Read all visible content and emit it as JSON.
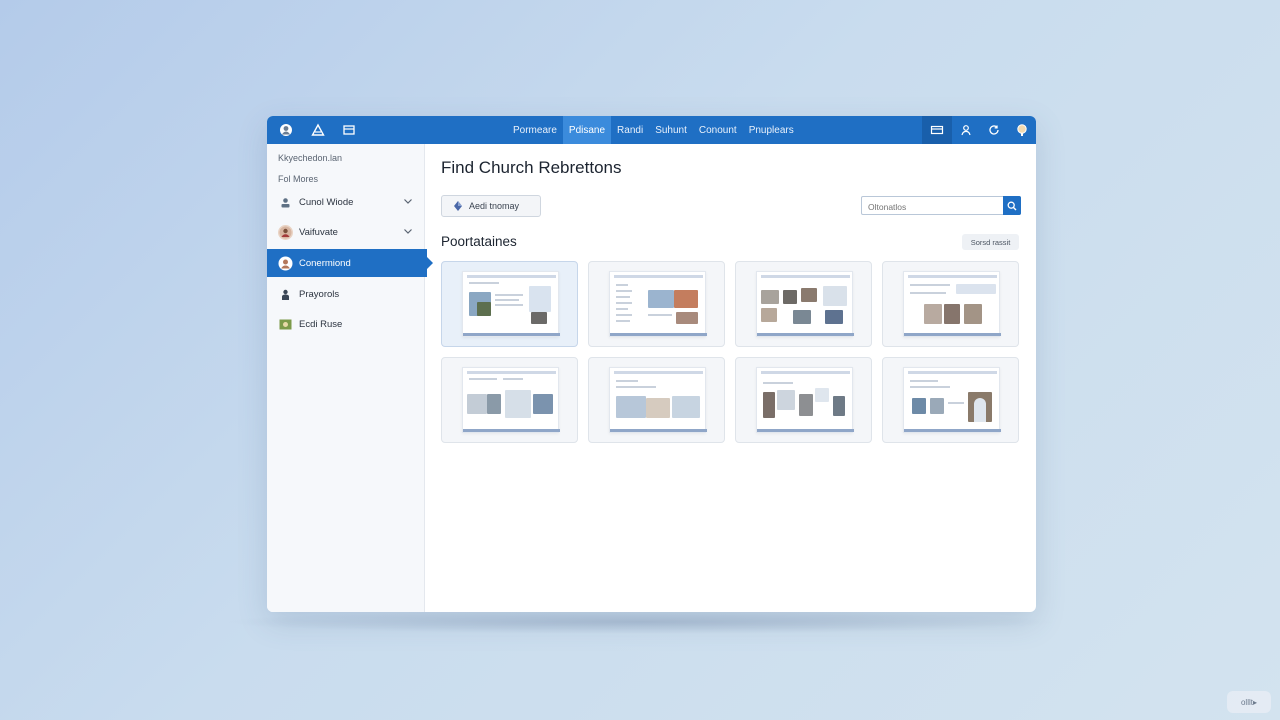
{
  "topbar": {
    "tabs": [
      {
        "label": "Pormeare",
        "active": false
      },
      {
        "label": "Pdisane",
        "active": true
      },
      {
        "label": "Randi",
        "active": false
      },
      {
        "label": "Suhunt",
        "active": false
      },
      {
        "label": "Conount",
        "active": false
      },
      {
        "label": "Pnuplears",
        "active": false
      }
    ],
    "left_icons": [
      "avatar-icon",
      "triangle-icon",
      "folder-icon"
    ],
    "right_icons": [
      "card-icon",
      "user-icon",
      "refresh-icon",
      "help-icon"
    ],
    "colors": {
      "bar": "#1f6fc4",
      "active_tab": "#3b8bdc"
    }
  },
  "sidebar": {
    "heading_1": "Kkyechedon.lan",
    "heading_2": "Fol Mores",
    "items": [
      {
        "label": "Cunol Wiode",
        "icon": "user-badge-icon",
        "expandable": true,
        "active": false
      },
      {
        "label": "Vaifuvate",
        "icon": "avatar-icon",
        "expandable": true,
        "active": false
      },
      {
        "label": "Conermiond",
        "icon": "avatar-icon",
        "expandable": false,
        "active": true
      },
      {
        "label": "Prayorols",
        "icon": "person-icon",
        "expandable": false,
        "active": false
      },
      {
        "label": "Ecdi Ruse",
        "icon": "image-icon",
        "expandable": false,
        "active": false
      }
    ]
  },
  "main": {
    "title": "Find Church Rebrettons",
    "add_button": "Aedi tnomay",
    "search_placeholder": "Oltonatlos",
    "section_title": "Poortataines",
    "sort_label": "Sorsd rassit"
  },
  "watermark": "olllt▸"
}
